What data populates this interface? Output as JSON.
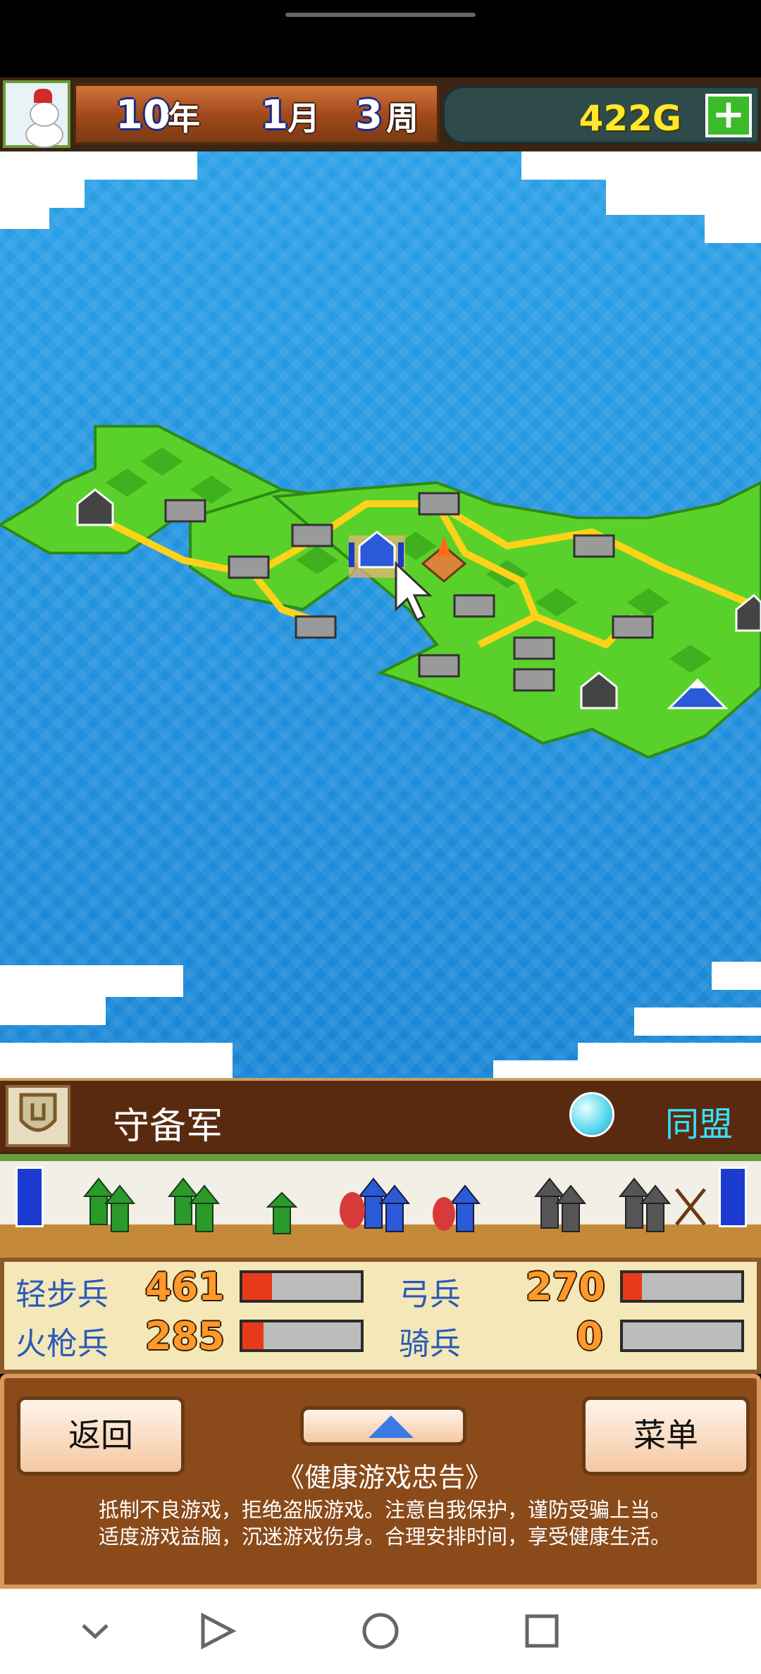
{
  "hud": {
    "year": "10",
    "year_unit": "年",
    "month": "1",
    "month_unit": "月",
    "week": "3",
    "week_unit": "周",
    "gold": "422G",
    "plus": "+"
  },
  "army": {
    "name": "守备军",
    "alliance": "同盟"
  },
  "stats": [
    {
      "label": "轻步兵",
      "value": "461",
      "fill": 0.25
    },
    {
      "label": "弓兵",
      "value": "270",
      "fill": 0.16
    },
    {
      "label": "火枪兵",
      "value": "285",
      "fill": 0.18
    },
    {
      "label": "骑兵",
      "value": "0",
      "fill": 0
    }
  ],
  "menu": {
    "back": "返回",
    "menu": "菜单",
    "advice_title": "《健康游戏忠告》",
    "advice_line1": "抵制不良游戏，拒绝盗版游戏。注意自我保护，谨防受骗上当。",
    "advice_line2": "适度游戏益脑，沉迷游戏伤身。合理安排时间，享受健康生活。"
  },
  "colors": {
    "sea": "#1a86d6",
    "land": "#5ad12a",
    "road": "#ffd21a",
    "gold_text": "#ffe72a",
    "alliance_text": "#36e0ff",
    "stat_label": "#2a5ab8"
  }
}
